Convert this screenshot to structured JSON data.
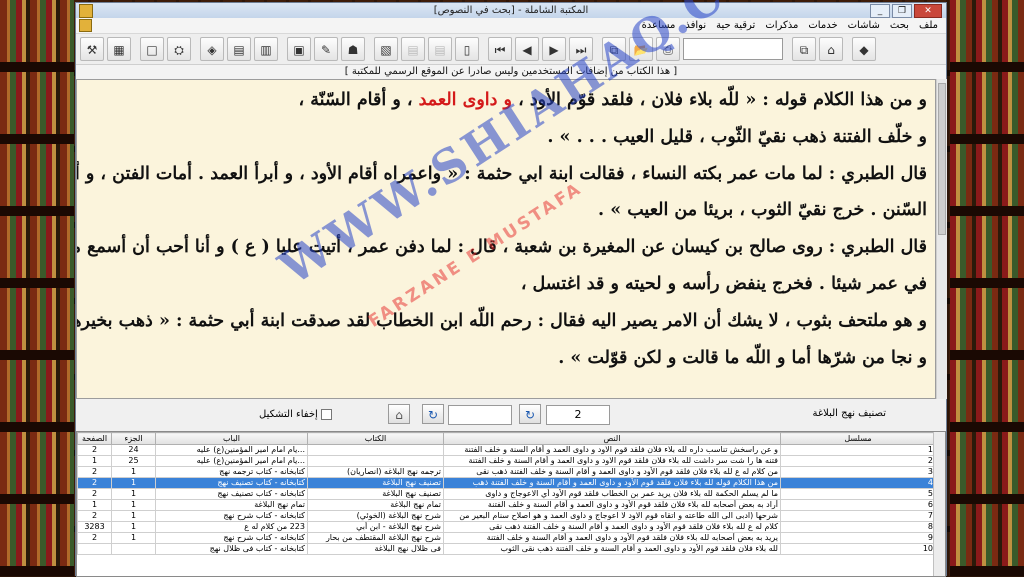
{
  "window": {
    "title": "المكتبة الشاملة - [بحث في النصوص]",
    "buttons": [
      "_",
      "❐",
      "✕"
    ]
  },
  "menu": {
    "items": [
      "ملف",
      "بحث",
      "شاشات",
      "خدمات",
      "مذكرات",
      "ترقية حية",
      "نوافذ",
      "مساعدة"
    ]
  },
  "toolbar": {
    "icons": [
      "tools-icon",
      "calculator-icon",
      "new-page-icon",
      "binoculars-icon",
      "copy-icon",
      "doc-icon",
      "pages-icon",
      "folder-note-icon",
      "pencil-icon",
      "bookmark-icon",
      "format-icon",
      "list-dim-icon",
      "list-dim-icon",
      "book-icon",
      "first-icon",
      "prev-icon",
      "next-icon",
      "last-icon",
      "window-icon",
      "open-folder-icon",
      "print-icon",
      "copy2-icon",
      "tag-icon",
      "eraser-icon"
    ],
    "glyphs": [
      "⚒",
      "▦",
      "□",
      "⛭",
      "◈",
      "▤",
      "▥",
      "▣",
      "✎",
      "☗",
      "▧",
      "▤",
      "▤",
      "▯",
      "⏮",
      "◀",
      "▶",
      "⏭",
      "⧉",
      "📂",
      "⎙",
      "⧉",
      "⌂",
      "◆"
    ]
  },
  "banner": "[ هذا الكتاب من إضافات المستخدمين وليس صادرا عن الموقع الرسمي للمكتبة ]",
  "text": {
    "line1_a": "و من هذا الكلام قوله : « للّه بلاء فلان ، فلقد قوّم الأود ، ",
    "line1_red": "و داوى العمد",
    "line1_b": " ، و أقام السّنّة ،",
    "line2": "و خلّف الفتنة ذهب نقيّ الثّوب ، قليل العيب . . . » .",
    "line3": "قال الطبري : لما مات عمر بكته النساء ، فقالت ابنة ابي حثمة : « واعمراه أقام الأود ، و أبرأ العمد . أمات الفتن ، و أحيا",
    "line4": "السّنن . خرج نقيّ الثوب ، بريئا من العيب » .",
    "line5": "قال الطبري : روى صالح بن كيسان عن المغيرة بن شعبة ، قال : لما دفن عمر ، أتيت عليا ( ع ) و أنا أحب أن أسمع منه",
    "line6": "في عمر شيئا . فخرج ينفض رأسه و لحيته و قد اغتسل ،",
    "line7": "و هو ملتحف بثوب ، لا يشك أن الامر يصير اليه فقال : رحم اللّه ابن الخطاب لقد صدقت ابنة أبي حثمة : « ذهب بخيرها",
    "line8": "و نجا من شرّها أما و اللّه ما قالت و لكن قوّلت » ."
  },
  "controls": {
    "category_label": "تصنيف نهج البلاغة",
    "page_value": "2",
    "hide_tashkeel": "إخفاء التشكيل",
    "refresh_glyph": "↻",
    "tag_glyph": "⌂"
  },
  "table": {
    "headers": [
      "مسلسل",
      "النص",
      "الكتاب",
      "الباب",
      "الجزء",
      "الصفحة"
    ],
    "rows": [
      [
        "1",
        "و عن راسخش تناسب داره لله بلاء فلان فلقد قوم الاود و داوى العمد و أقام السنة و خلف الفتنة",
        "",
        "...يام امام امير المؤمنين(ع) عليه",
        "24",
        "2"
      ],
      [
        "2",
        "فتنه ها را شت سر داشت لله بلاء فلان فلقد قوم الاود و داوى العمد و أقام السنة و خلف الفتنة",
        "",
        "...يام امام امير المؤمنين(ع) عليه",
        "25",
        "1"
      ],
      [
        "3",
        "من كلام له ع لله بلاء فلان فلقد قوم الأود و داوى العمد و أقام السنة و خلف الفتنة ذهب نقى",
        "ترجمه نهج البلاغه (انصاريان)",
        "كتابخانه - كتاب ترجمه نهج",
        "1",
        "2"
      ],
      [
        "4",
        "من هذا الكلام قوله لله بلاء فلان فلقد قوم الأود و داوى العمد و أقام السنة و خلف الفتنة ذهب",
        "تصنيف نهج البلاغة",
        "كتابخانه - كتاب تصنيف نهج",
        "1",
        "2"
      ],
      [
        "5",
        "ما لم يسلّم الحكمة لله بلاء فلان يريد عمر بن الخطاب فلقد قوم الأود أي الاعوجاج و داوى",
        "تصنيف نهج البلاغة",
        "كتابخانه - كتاب تصنيف نهج",
        "1",
        "2"
      ],
      [
        "6",
        "أراد به بعض أصحابه لله بلاء فلان فلقد قوم الأود و داوى العمد و أقام السنة و خلف الفتنة",
        "تمام نهج البلاغة",
        "تمام نهج البلاغة",
        "1",
        "1"
      ],
      [
        "7",
        "شرحها (ادبى الى الله طاعته و اتقاه قوم الاود لا اعوجاج و داوى العمد و هو اصلاح سنام البعير من",
        "شرح نهج البلاغة (الخوئي)",
        "كتابخانه - كتاب شرح نهج",
        "1",
        "2"
      ],
      [
        "8",
        "كلام له ع لله بلاء فلان فلقد قوم الأود و داوى العمد و أقام السنة و خلف الفتنة ذهب نقى",
        "شرح نهج البلاغة - ابن أبي",
        "223 من كلام له ع",
        "1",
        "3283"
      ],
      [
        "9",
        "يريد به بعض أصحابه لله بلاء فلان فلقد قوم الأود و داوى العمد و أقام السنة و خلف الفتنة",
        "شرح نهج البلاغة المقتطف من بحار",
        "كتابخانه - كتاب شرح نهج",
        "1",
        "2"
      ],
      [
        "10",
        "لله بلاء فلان فلقد قوم الأود و داوى العمد و أقام السنة و خلف الفتنة ذهب نقى الثوب",
        "فى ظلال نهج البلاغة",
        "كتابخانه - كتاب فى ظلال نهج",
        "",
        ""
      ]
    ]
  },
  "watermark": {
    "main": "WWW.SHIAHAQ.COM",
    "sub": "FARZANE E MUSTAFA"
  }
}
